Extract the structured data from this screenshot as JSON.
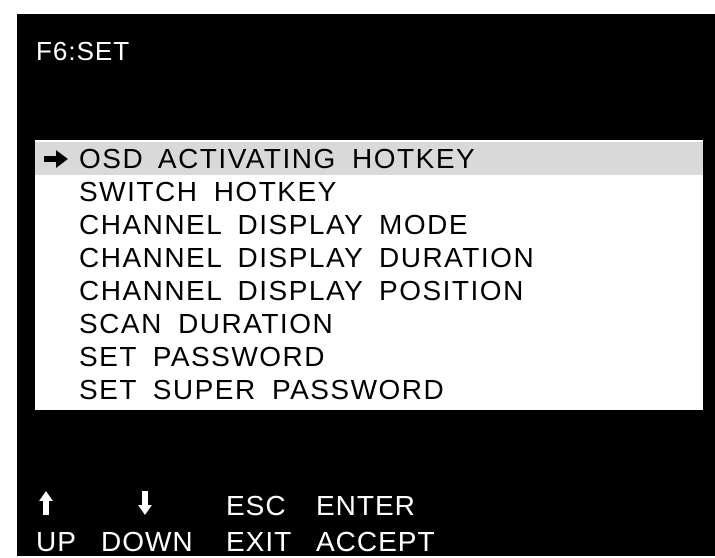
{
  "header": {
    "title": "F6:SET"
  },
  "menu": {
    "items": [
      {
        "label": "OSD ACTIVATING HOTKEY",
        "selected": true
      },
      {
        "label": "SWITCH HOTKEY",
        "selected": false
      },
      {
        "label": "CHANNEL  DISPLAY MODE",
        "selected": false
      },
      {
        "label": "CHANNEL  DISPLAY DURATION",
        "selected": false
      },
      {
        "label": "CHANNEL  DISPLAY POSITION",
        "selected": false
      },
      {
        "label": "SCAN DURATION",
        "selected": false
      },
      {
        "label": "SET PASSWORD",
        "selected": false
      },
      {
        "label": "SET SUPER PASSWORD",
        "selected": false
      }
    ],
    "selection_icon": "right-arrow-icon"
  },
  "footer": {
    "up": {
      "icon": "up-arrow-icon",
      "label": "UP"
    },
    "down": {
      "icon": "down-arrow-icon",
      "label": "DOWN"
    },
    "exit": {
      "key": "ESC",
      "label": "EXIT"
    },
    "accept": {
      "key": "ENTER",
      "label": "ACCEPT"
    }
  },
  "colors": {
    "background": "#000000",
    "menu_background": "#ffffff",
    "selected_row": "#d9d9d9",
    "text": "#ffffff"
  }
}
